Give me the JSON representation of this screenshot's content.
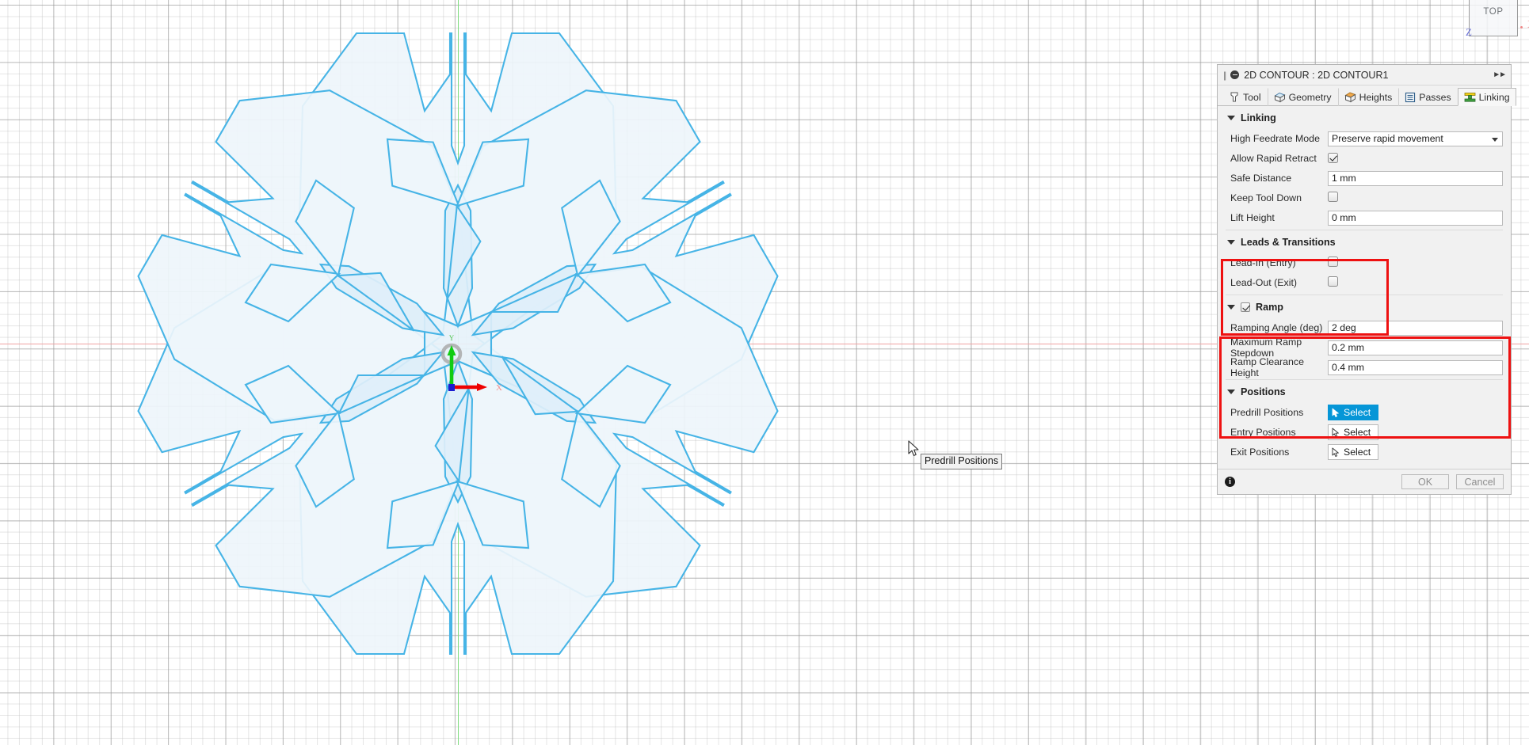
{
  "viewcube": {
    "label": "TOP",
    "axis_z": "Z",
    "axis_x": "X"
  },
  "origin": {
    "axis_y_label": "Y",
    "axis_x_label": "X"
  },
  "tooltip": {
    "text": "Predrill Positions"
  },
  "panel": {
    "title": "2D CONTOUR : 2D CONTOUR1",
    "expand_icon": "double-chevron-right-icon",
    "collapse_icon": "minus-circle-icon",
    "tabs": [
      {
        "label": "Tool",
        "icon": "tool-icon",
        "active": false
      },
      {
        "label": "Geometry",
        "icon": "geometry-icon",
        "active": false
      },
      {
        "label": "Heights",
        "icon": "heights-icon",
        "active": false
      },
      {
        "label": "Passes",
        "icon": "passes-icon",
        "active": false
      },
      {
        "label": "Linking",
        "icon": "linking-icon",
        "active": true
      }
    ],
    "sections": {
      "linking": {
        "header": "Linking",
        "high_feedrate_mode": {
          "label": "High Feedrate Mode",
          "value": "Preserve rapid movement"
        },
        "allow_rapid_retract": {
          "label": "Allow Rapid Retract",
          "checked": true
        },
        "safe_distance": {
          "label": "Safe Distance",
          "value": "1 mm"
        },
        "keep_tool_down": {
          "label": "Keep Tool Down",
          "checked": false
        },
        "lift_height": {
          "label": "Lift Height",
          "value": "0 mm"
        }
      },
      "leads": {
        "header": "Leads & Transitions",
        "lead_in": {
          "label": "Lead-In (Entry)",
          "checked": false
        },
        "lead_out": {
          "label": "Lead-Out (Exit)",
          "checked": false
        },
        "highlighted": true
      },
      "ramp": {
        "header": "Ramp",
        "enabled": true,
        "ramping_angle": {
          "label": "Ramping Angle (deg)",
          "value": "2 deg"
        },
        "maximum_ramp_stepdown": {
          "label": "Maximum Ramp Stepdown",
          "value": "0.2 mm"
        },
        "ramp_clearance_height": {
          "label": "Ramp Clearance Height",
          "value": "0.4 mm"
        },
        "highlighted": true
      },
      "positions": {
        "header": "Positions",
        "predrill": {
          "label": "Predrill Positions",
          "button": "Select",
          "primary": true
        },
        "entry": {
          "label": "Entry Positions",
          "button": "Select",
          "primary": false
        },
        "exit": {
          "label": "Exit Positions",
          "button": "Select",
          "primary": false
        }
      }
    },
    "footer": {
      "info_icon": "info-icon",
      "info_glyph": "i",
      "ok": "OK",
      "cancel": "Cancel"
    }
  },
  "colors": {
    "accent_blue": "#0696d7",
    "sketch_line": "#46b4e6",
    "sketch_fill": "#eff6fb",
    "annotation_red": "#ee1111",
    "axis_x": "#f0a3a3",
    "axis_y": "#7fdc7f",
    "panel_bg": "#f1f1f1"
  }
}
